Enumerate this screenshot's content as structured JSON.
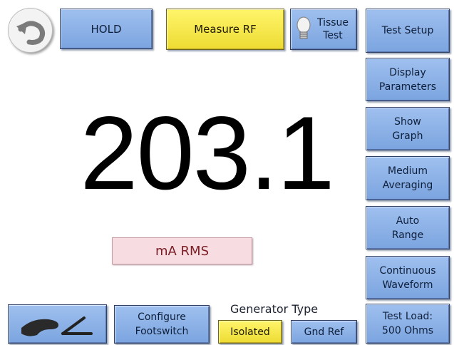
{
  "toolbar": {
    "hold_label": "HOLD",
    "measure_label": "Measure RF",
    "tissue_test_label": "Tissue\nTest"
  },
  "sidebar": {
    "test_setup": "Test Setup",
    "display_parameters": "Display\nParameters",
    "show_graph": "Show\nGraph",
    "averaging": "Medium\nAveraging",
    "range": "Auto\nRange",
    "waveform": "Continuous\nWaveform",
    "test_load": "Test Load:\n500 Ohms"
  },
  "reading": {
    "value": "203.1",
    "unit": "mA RMS"
  },
  "bottom": {
    "configure_footswitch": "Configure\nFootswitch",
    "generator_type_title": "Generator Type",
    "isolated_label": "Isolated",
    "gnd_ref_label": "Gnd Ref"
  },
  "icons": {
    "back": "back-arrow-icon",
    "tissue": "lightbulb-icon",
    "footswitch": "footswitch-icon"
  },
  "colors": {
    "button_blue": "#8fb3e8",
    "button_yellow": "#f6e84a",
    "unit_box": "#f7dde2",
    "unit_text": "#7a1d24"
  }
}
